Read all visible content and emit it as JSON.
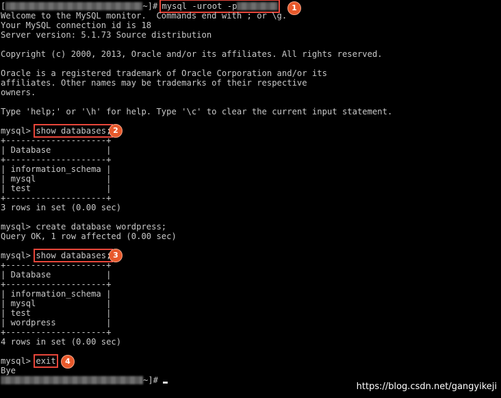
{
  "terminal": {
    "prompt_open": "[",
    "prompt_close": "~]#",
    "login_command": "mysql -uroot -p",
    "lines": {
      "welcome": "Welcome to the MySQL monitor.  Commands end with ; or \\g.",
      "conn_id": "Your MySQL connection id is 18",
      "server": "Server version: 5.1.73 Source distribution",
      "copyright": "Copyright (c) 2000, 2013, Oracle and/or its affiliates. All rights reserved.",
      "trademark1": "Oracle is a registered trademark of Oracle Corporation and/or its",
      "trademark2": "affiliates. Other names may be trademarks of their respective",
      "trademark3": "owners.",
      "help": "Type 'help;' or '\\h' for help. Type '\\c' to clear the current input statement."
    },
    "mysql_prompt": "mysql>",
    "cmd_show1": "show databases;",
    "table1": {
      "border": "+--------------------+",
      "header": "| Database           |",
      "rows": [
        "| information_schema |",
        "| mysql              |",
        "| test               |"
      ],
      "footer": "3 rows in set (0.00 sec)"
    },
    "cmd_create": "create database wordpress;",
    "create_result": "Query OK, 1 row affected (0.00 sec)",
    "cmd_show2": "show databases;",
    "table2": {
      "border": "+--------------------+",
      "header": "| Database           |",
      "rows": [
        "| information_schema |",
        "| mysql              |",
        "| test               |",
        "| wordpress          |"
      ],
      "footer": "4 rows in set (0.00 sec)"
    },
    "cmd_exit": "exit",
    "bye": "Bye"
  },
  "annotations": {
    "badge1": "1",
    "badge2": "2",
    "badge3": "3",
    "badge4": "4",
    "accent_color": "#e8592b"
  },
  "watermark": "https://blog.csdn.net/gangyikeji"
}
